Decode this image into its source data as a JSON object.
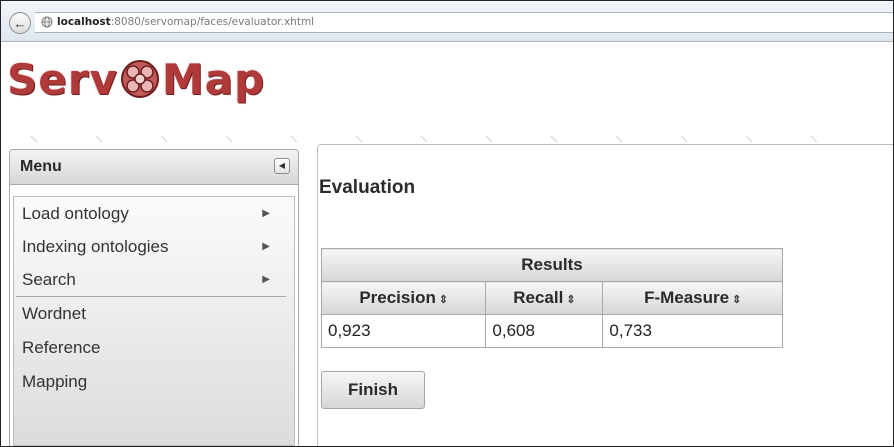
{
  "browser": {
    "url_host": "localhost",
    "url_rest": ":8080/servomap/faces/evaluator.xhtml"
  },
  "logo": {
    "part1": "Serv",
    "part2": "Map"
  },
  "menu": {
    "title": "Menu",
    "items": [
      {
        "label": "Load ontology",
        "submenu": true
      },
      {
        "label": "Indexing ontologies",
        "submenu": true
      },
      {
        "label": "Search",
        "submenu": true
      },
      {
        "label": "Wordnet",
        "submenu": false
      },
      {
        "label": "Reference",
        "submenu": false
      },
      {
        "label": "Mapping",
        "submenu": false
      }
    ]
  },
  "main": {
    "title": "Evaluation",
    "table": {
      "caption": "Results",
      "columns": [
        "Precision",
        "Recall",
        "F-Measure"
      ],
      "rows": [
        [
          "0,923",
          "0,608",
          "0,733"
        ]
      ]
    },
    "finish_label": "Finish"
  },
  "colors": {
    "logo": "#b03a3a"
  },
  "icons": [
    "back-arrow-icon",
    "globe-icon",
    "collapse-icon",
    "chevron-right-icon",
    "sort-icon"
  ]
}
